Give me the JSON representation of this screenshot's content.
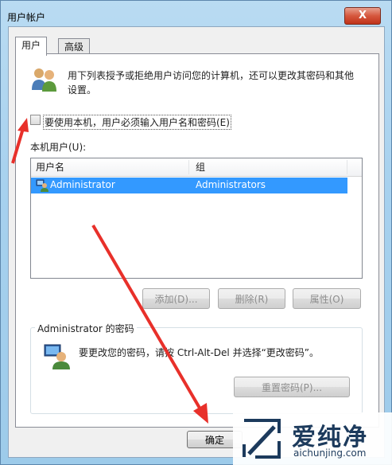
{
  "window": {
    "title": "用户帐户",
    "close_glyph": "X"
  },
  "tabs": [
    {
      "label": "用户"
    },
    {
      "label": "高级"
    }
  ],
  "intro": {
    "text_line1": "用下列表授予或拒绝用户访问您的计算机，还可以更改其密码和其他",
    "text_line2": "设置。"
  },
  "require_password": {
    "label": "要使用本机，用户必须输入用户名和密码(E)",
    "checked": false
  },
  "users_list": {
    "label": "本机用户(U):",
    "columns": [
      "用户名",
      "组"
    ],
    "rows": [
      {
        "username": "Administrator",
        "group": "Administrators",
        "selected": true
      }
    ]
  },
  "list_buttons": {
    "add": "添加(D)...",
    "remove": "删除(R)",
    "properties": "属性(O)"
  },
  "password_group": {
    "title": "Administrator 的密码",
    "text": "要更改您的密码，请按 Ctrl-Alt-Del 并选择“更改密码”。",
    "reset_button": "重置密码(P)..."
  },
  "dialog_buttons": {
    "ok": "确定"
  },
  "watermark": {
    "brand": "爱纯净",
    "url": "aichunjing.com"
  },
  "colors": {
    "selection": "#3399ff",
    "annotation_arrow": "#e8302a"
  }
}
